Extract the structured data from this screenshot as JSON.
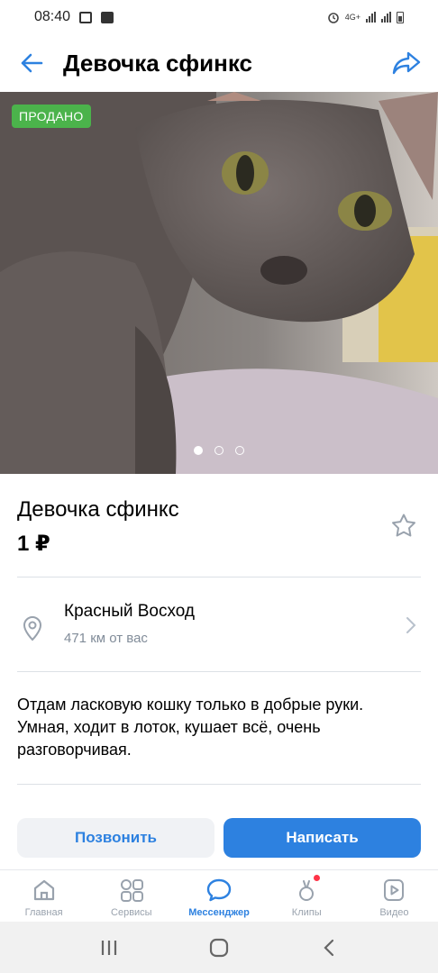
{
  "status_bar": {
    "time": "08:40",
    "network": "4G+"
  },
  "header": {
    "title": "Девочка сфинкс"
  },
  "photo": {
    "badge": "ПРОДАНО",
    "pages_total": 3,
    "page_current": 1
  },
  "item": {
    "title": "Девочка сфинкс",
    "price": "1 ₽",
    "location": "Красный Восход",
    "distance": "471 км от вас",
    "description": "Отдам ласковую кошку только в добрые руки. Умная, ходит в лоток, кушает всё, очень разговорчивая."
  },
  "actions": {
    "call_label": "Позвонить",
    "write_label": "Написать"
  },
  "tabbar": {
    "items": [
      {
        "label": "Главная",
        "icon": "home-icon"
      },
      {
        "label": "Сервисы",
        "icon": "services-icon"
      },
      {
        "label": "Мессенджер",
        "icon": "messenger-icon",
        "active": true
      },
      {
        "label": "Клипы",
        "icon": "clips-icon",
        "notification": true
      },
      {
        "label": "Видео",
        "icon": "video-icon"
      }
    ]
  },
  "colors": {
    "accent": "#2d81e0",
    "sold_badge": "#4bb34b",
    "secondary_text": "#818c99",
    "notification": "#ff3347"
  }
}
